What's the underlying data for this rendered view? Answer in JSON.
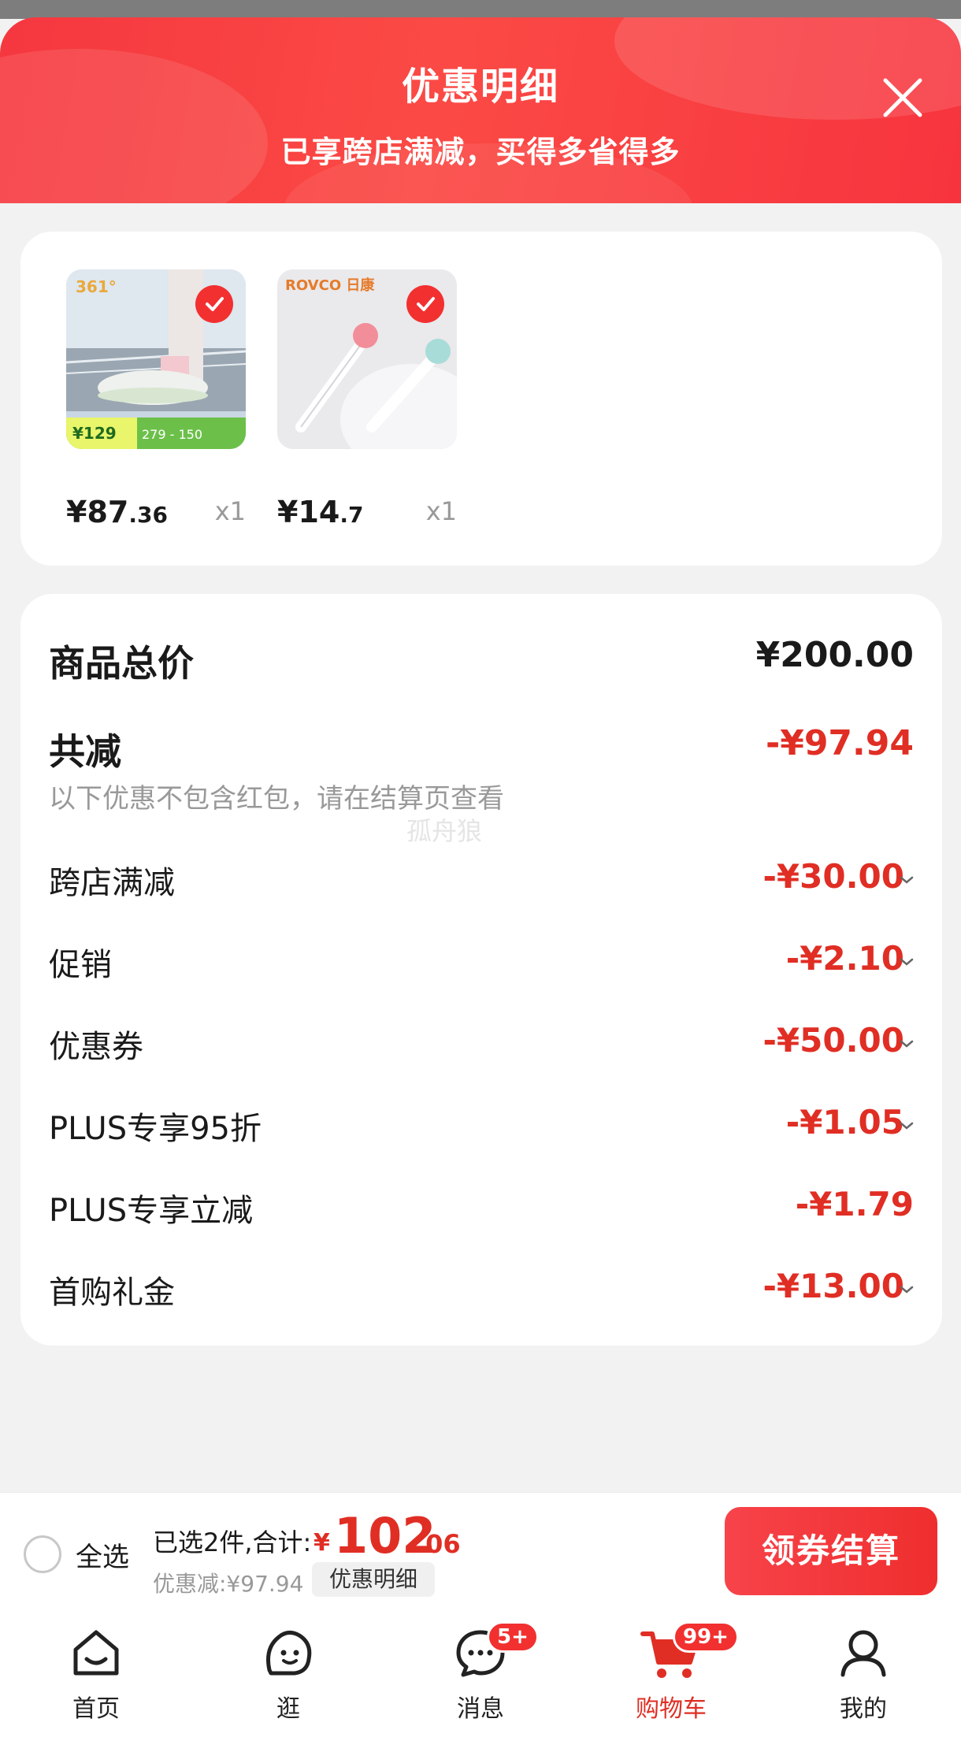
{
  "header": {
    "title": "优惠明细",
    "subtitle": "已享跨店满减，买得多省得多"
  },
  "products": [
    {
      "price_int": "¥87",
      "price_dec": ".36",
      "qty": "x1",
      "image": "sneaker-photo"
    },
    {
      "price_int": "¥14",
      "price_dec": ".7",
      "qty": "x1",
      "image": "ear-cleaner-photo"
    }
  ],
  "product_image_text": {
    "brand_1": "361°",
    "price_tag_1": "¥129",
    "promo_1": "279 - 150",
    "brand_2": "ROVCO 日康"
  },
  "summary": {
    "total_label": "商品总价",
    "total_value": "¥200.00",
    "reduce_label": "共减",
    "reduce_value": "-¥97.94",
    "note": "以下优惠不包含红包，请在结算页查看",
    "watermark": "孤舟狼",
    "items": [
      {
        "label": "跨店满减",
        "value": "-¥30.00"
      },
      {
        "label": "促销",
        "value": "-¥2.10"
      },
      {
        "label": "优惠券",
        "value": "-¥50.00"
      },
      {
        "label": "PLUS专享95折",
        "value": "-¥1.05"
      },
      {
        "label": "PLUS专享立减",
        "value": "-¥1.79"
      },
      {
        "label": "首购礼金",
        "value": "-¥13.00"
      }
    ]
  },
  "footer": {
    "select_all": "全选",
    "selected_text": "已选2件,合计:",
    "total_symbol": "¥",
    "total_int": "102",
    "total_dec": ".06",
    "discount_text": "优惠减:¥97.94",
    "detail_tag": "优惠明细",
    "checkout": "领券结算"
  },
  "tabs": [
    {
      "label": "首页",
      "icon": "home-icon"
    },
    {
      "label": "逛",
      "icon": "browse-icon"
    },
    {
      "label": "消息",
      "icon": "message-icon",
      "badge": "5+"
    },
    {
      "label": "购物车",
      "icon": "cart-icon",
      "badge": "99+",
      "active": true
    },
    {
      "label": "我的",
      "icon": "profile-icon"
    }
  ],
  "colors": {
    "accent": "#e02e24",
    "header": "#f5373f"
  }
}
